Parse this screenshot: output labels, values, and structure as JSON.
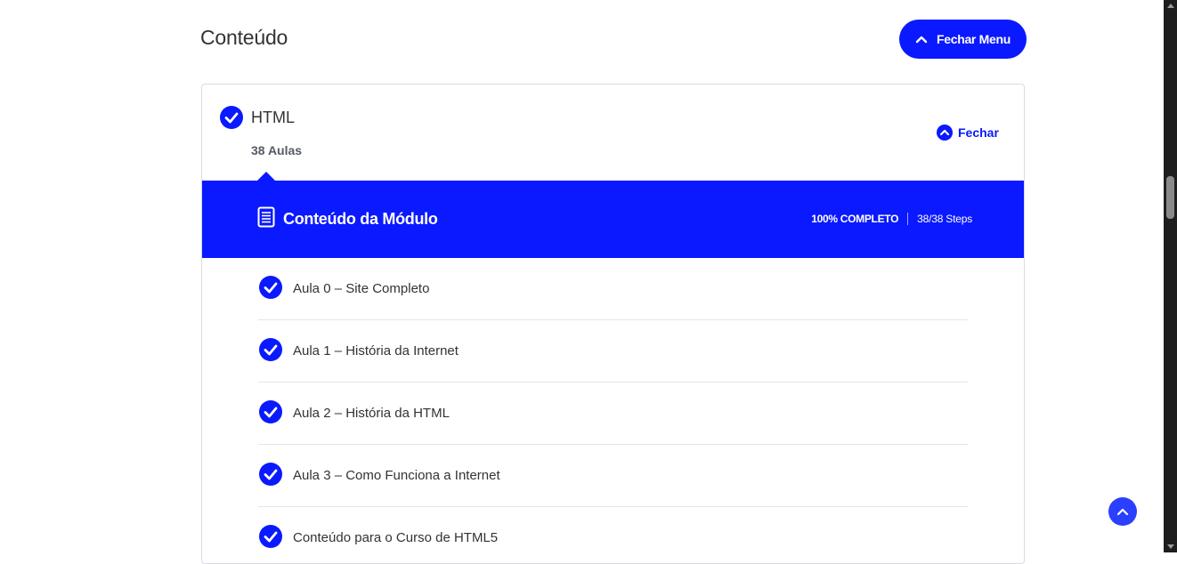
{
  "header": {
    "title": "Conteúdo",
    "close_menu_label": "Fechar Menu"
  },
  "module": {
    "name": "HTML",
    "lesson_count": "38 Aulas",
    "close_label": "Fechar",
    "content_title": "Conteúdo da Módulo",
    "progress_percent_label": "100% COMPLETO",
    "steps_label": "38/38 Steps",
    "progress_fraction": 1.0
  },
  "lessons": [
    {
      "title": "Aula 0 – Site Completo",
      "completed": true
    },
    {
      "title": "Aula 1 – História da Internet",
      "completed": true
    },
    {
      "title": "Aula 2 – História da HTML",
      "completed": true
    },
    {
      "title": "Aula 3 – Como Funciona a Internet",
      "completed": true
    },
    {
      "title": "Conteúdo para o Curso de HTML5",
      "completed": true
    }
  ],
  "colors": {
    "accent": "#0a19ff",
    "back_to_top": "#2b3fff",
    "text": "#333333"
  },
  "icons": {
    "close_menu": "chevron-up-icon",
    "check": "check-circle-icon",
    "fechar": "chevron-up-circle-icon",
    "content": "document-icon",
    "back_to_top": "chevron-up-icon"
  }
}
